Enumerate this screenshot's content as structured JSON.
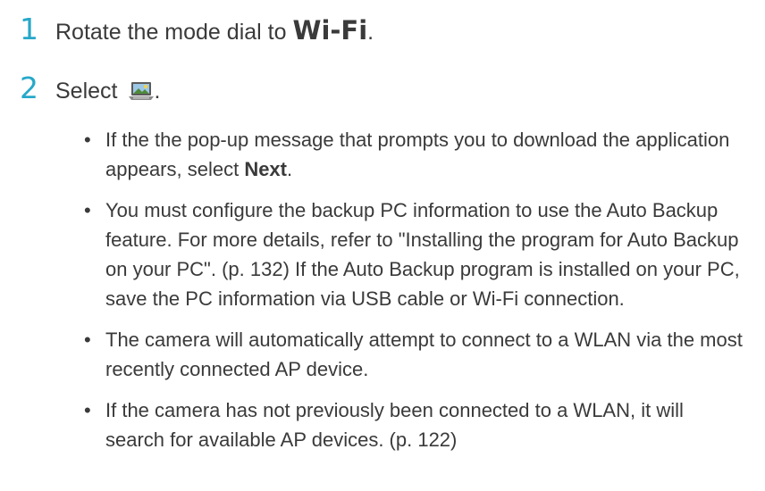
{
  "steps": [
    {
      "number": "1",
      "prefix": "Rotate the mode dial to ",
      "mode": "Wi-Fi",
      "suffix": "."
    },
    {
      "number": "2",
      "prefix": "Select ",
      "icon": "pc-auto-backup-icon",
      "suffix": "."
    }
  ],
  "bullets": [
    {
      "before": "If the the pop-up message that prompts you to download the application appears, select ",
      "bold": "Next",
      "after": "."
    },
    {
      "text": "You must configure the backup PC information to use the Auto Backup feature. For more details, refer to \"Installing the program for Auto Backup on your PC\". (p. 132) If the Auto Backup program is installed on your PC, save the PC information via USB cable or Wi-Fi connection."
    },
    {
      "text": "The camera will automatically attempt to connect to a WLAN via the most recently connected AP device."
    },
    {
      "text": "If the camera has not previously been connected to a WLAN, it will search for available AP devices. (p. 122)"
    }
  ],
  "colors": {
    "accent": "#27a8c9",
    "text": "#3a3a3a"
  }
}
